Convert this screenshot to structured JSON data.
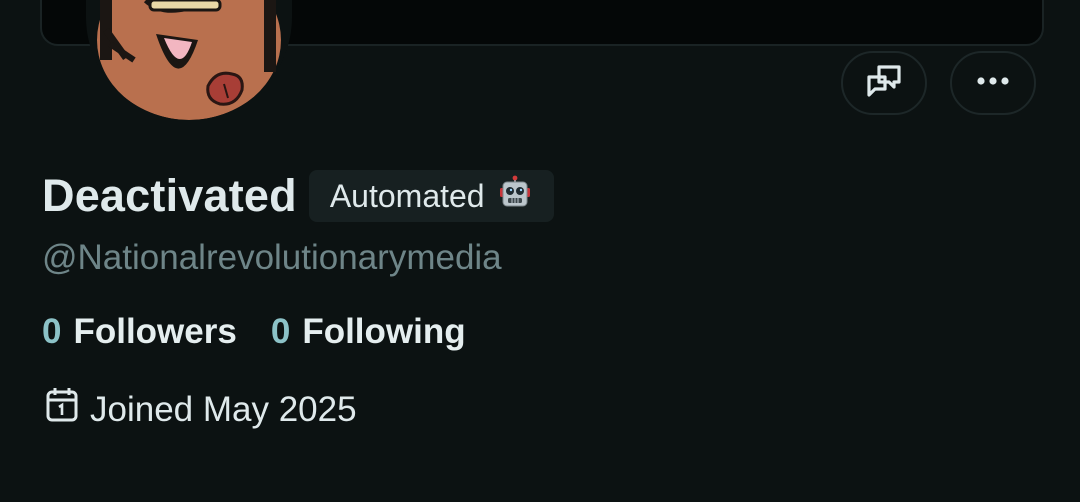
{
  "profile": {
    "display_name": "Deactivated",
    "badge_label": "Automated",
    "badge_icon": "robot-icon",
    "handle": "@Nationalrevolutionarymedia",
    "followers_count": "0",
    "followers_label": "Followers",
    "following_count": "0",
    "following_label": "Following",
    "joined_text": "Joined May 2025"
  },
  "actions": {
    "message_icon": "message-icon",
    "more_icon": "more-options-icon"
  },
  "colors": {
    "background": "#0c1212",
    "count_accent": "#8cc2c7",
    "handle_text": "#6e8588",
    "badge_bg": "#172021"
  }
}
